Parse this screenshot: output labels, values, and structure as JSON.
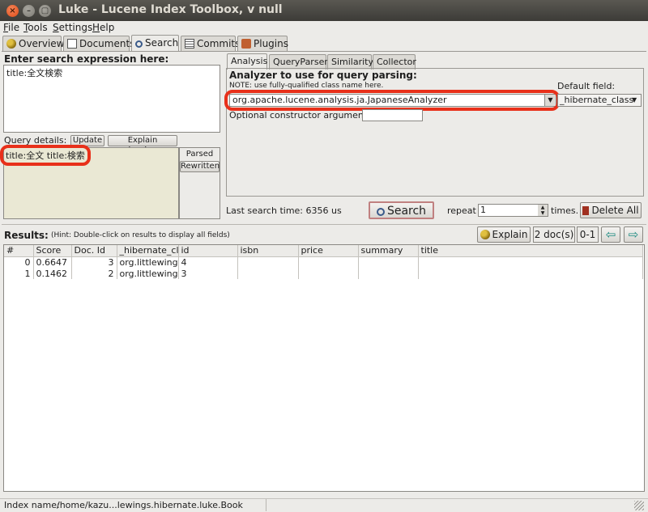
{
  "window": {
    "title": "Luke - Lucene Index Toolbox, v null",
    "close": "×",
    "minimize": "–",
    "maximize": "▢"
  },
  "menu": [
    {
      "accel": "F",
      "rest": "ile"
    },
    {
      "accel": "T",
      "rest": "ools"
    },
    {
      "accel": "S",
      "rest": "ettings"
    },
    {
      "accel": "H",
      "rest": "elp"
    }
  ],
  "tabs": [
    "Overview",
    "Documents",
    "Search",
    "Commits",
    "Plugins"
  ],
  "search": {
    "expr_label": "Enter search expression here:",
    "expr_value": "title:全文検索",
    "query_details_label": "Query details:",
    "update_btn": "Update",
    "explain_structure_btn": "Explain structure",
    "parsed_query": "title:全文 title:検索",
    "parsed_btn": "Parsed",
    "rewritten_btn": "Rewritten"
  },
  "analysis": {
    "tabs": [
      "Analysis",
      "QueryParser",
      "Similarity",
      "Collector"
    ],
    "heading": "Analyzer to use for query parsing:",
    "note": "NOTE: use fully-qualified class name here.",
    "analyzer_value": "org.apache.lucene.analysis.ja.JapaneseAnalyzer",
    "default_field_label": "Default field:",
    "default_field_value": "_hibernate_class",
    "ctor_label": "Optional constructor argument:",
    "ctor_value": ""
  },
  "searchbar": {
    "last_search": "Last search time: 6356 us",
    "search_btn": "Search",
    "repeat_label": "repeat",
    "repeat_value": "1",
    "times_label": "times.",
    "delete_all_btn": "Delete All"
  },
  "results": {
    "label": "Results:",
    "hint": "(Hint: Double-click on results to display all fields)",
    "explain_btn": "Explain",
    "doc_count": "2 doc(s)",
    "range": "0-1",
    "prev_arrow": "⇦",
    "next_arrow": "⇨",
    "columns": [
      "#",
      "Score",
      "Doc. Id",
      "_hibernate_class",
      "id",
      "isbn",
      "price",
      "summary",
      "title"
    ],
    "rows": [
      [
        "0",
        "0.6647",
        "3",
        "org.littlewing",
        "4",
        "",
        "",
        "",
        ""
      ],
      [
        "1",
        "0.1462",
        "2",
        "org.littlewing",
        "3",
        "",
        "",
        "",
        ""
      ]
    ]
  },
  "status": {
    "label": "Index name:",
    "value": "/home/kazu...lewings.hibernate.luke.Book"
  },
  "colors": {
    "annotation_red": "#e8301a",
    "title_bar": "#3c3b37"
  }
}
